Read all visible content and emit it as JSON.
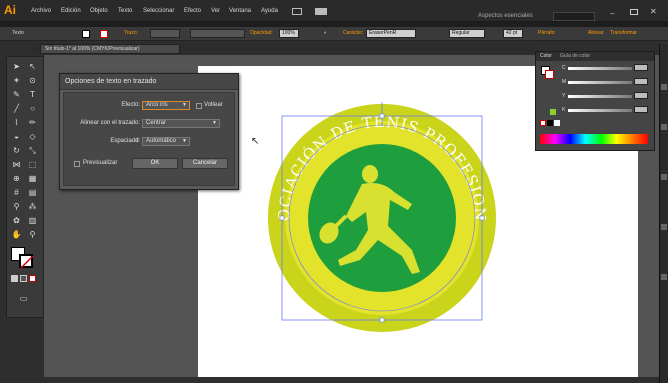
{
  "app": {
    "logo": "Ai"
  },
  "menu": [
    "Archivo",
    "Edición",
    "Objeto",
    "Texto",
    "Seleccionar",
    "Efecto",
    "Ver",
    "Ventana",
    "Ayuda"
  ],
  "workspace": {
    "label": "Aspectos esenciales"
  },
  "controlbar": {
    "type_label": "Texto",
    "stroke_label": "Trazo:",
    "opacity_label": "Opacidad:",
    "opacity_value": "100%",
    "char_label": "Carácter:",
    "font": "EraserPenR",
    "style": "Regular",
    "size": "42 pt",
    "para_label": "Párrafo:",
    "align_label": "Alinear",
    "transform_label": "Transformar"
  },
  "document": {
    "tab_label": "Sin título-1* al 100% (CMYK/Previsualizar)"
  },
  "dialog": {
    "title": "Opciones de texto en trazado",
    "effect_label": "Efecto:",
    "effect_value": "Arco iris",
    "flip_label": "Voltear",
    "align_label": "Alinear con el trazado:",
    "align_value": "Centrar",
    "spacing_label": "Espaciado:",
    "spacing_value": "Automático",
    "preview_label": "Previsualizar",
    "ok_label": "OK",
    "cancel_label": "Cancelar"
  },
  "color_panel": {
    "tabs": [
      "Color",
      "Guía de color"
    ],
    "channels": [
      "C",
      "M",
      "Y",
      "K"
    ]
  },
  "artwork": {
    "circle_text": "ASOCIACIÓN DE TENIS PROFESIONAL",
    "outer_color": "#c9d41b",
    "ring_color": "#e2e32a",
    "inner_color": "#1e9e3c",
    "figure_color": "#d8e030"
  }
}
